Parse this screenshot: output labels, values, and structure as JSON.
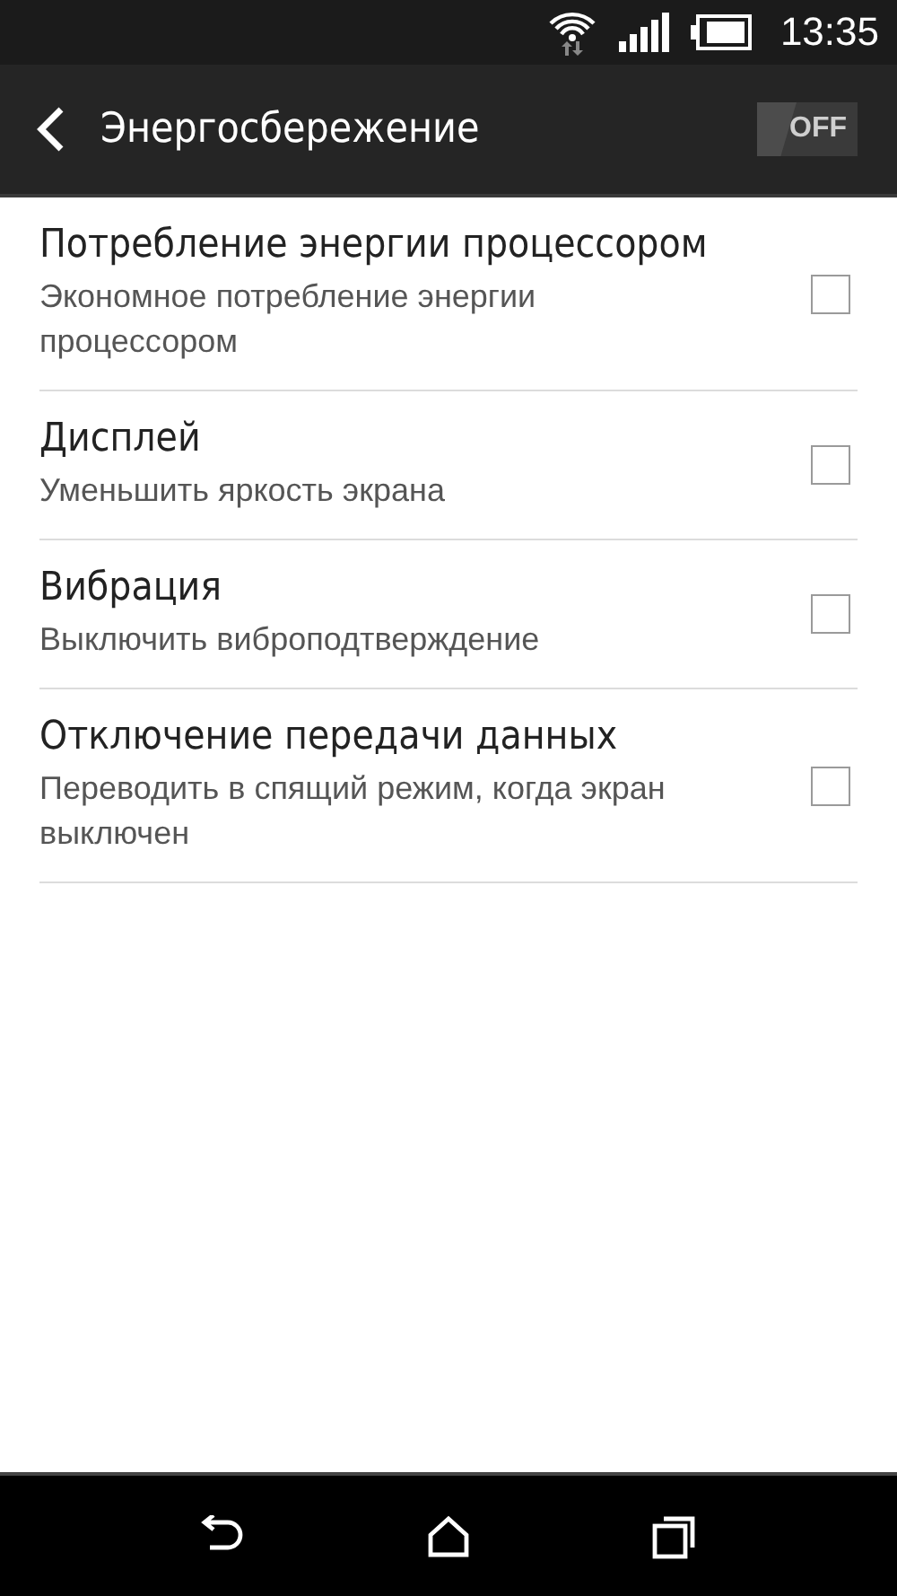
{
  "status_bar": {
    "time": "13:35"
  },
  "header": {
    "title": "Энергосбережение",
    "switch": {
      "label": "OFF",
      "on": false
    }
  },
  "settings": [
    {
      "title": "Потребление энергии процессором",
      "subtitle": "Экономное потребление энергии процессором",
      "checked": false
    },
    {
      "title": "Дисплей",
      "subtitle": "Уменьшить яркость экрана",
      "checked": false
    },
    {
      "title": "Вибрация",
      "subtitle": "Выключить виброподтверждение",
      "checked": false
    },
    {
      "title": "Отключение передачи данных",
      "subtitle": "Переводить в спящий режим, когда экран выключен",
      "checked": false
    }
  ]
}
